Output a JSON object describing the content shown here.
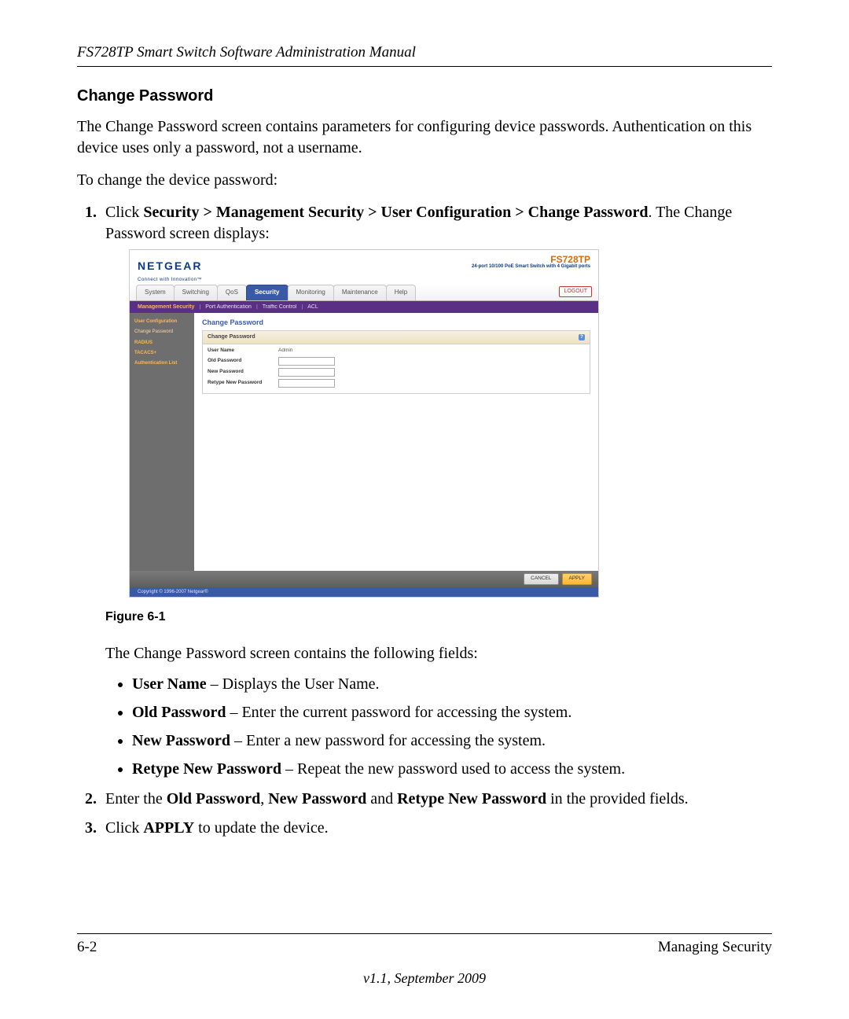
{
  "header": {
    "running_head": "FS728TP Smart Switch Software Administration Manual"
  },
  "section": {
    "title": "Change Password",
    "intro": "The Change Password screen contains parameters for configuring device passwords. Authentication on this device uses only a password, not a username.",
    "lead": "To change the device password:",
    "step1_prefix": "Click ",
    "step1_path": "Security > Management Security > User Configuration > Change Password",
    "step1_suffix": ". The Change Password screen displays:",
    "figure_caption": "Figure 6-1",
    "after_figure": "The Change Password screen contains the following fields:",
    "bullets": {
      "b0_term": "User Name",
      "b0_desc": " – Displays the User Name.",
      "b1_term": "Old Password",
      "b1_desc": " – Enter the current password for accessing the system.",
      "b2_term": "New Password",
      "b2_desc": " – Enter a new password for accessing the system.",
      "b3_term": "Retype New Password",
      "b3_desc": " – Repeat the new password used to access the system."
    },
    "step2_prefix": "Enter the ",
    "step2_t1": "Old Password",
    "step2_mid1": ", ",
    "step2_t2": "New Password",
    "step2_mid2": " and ",
    "step2_t3": "Retype New Password",
    "step2_suffix": " in the provided fields.",
    "step3_prefix": "Click ",
    "step3_term": "APPLY",
    "step3_suffix": " to update the device."
  },
  "footer": {
    "left": "6-2",
    "right": "Managing Security",
    "center": "v1.1, September 2009"
  },
  "screenshot": {
    "logo": "NETGEAR",
    "logo_tag": "Connect with Innovation™",
    "model": "FS728TP",
    "model_sub": "24-port 10/100 PoE Smart Switch with 4 Gigabit ports",
    "logout": "LOGOUT",
    "tabs": {
      "t0": "System",
      "t1": "Switching",
      "t2": "QoS",
      "t3": "Security",
      "t4": "Monitoring",
      "t5": "Maintenance",
      "t6": "Help"
    },
    "subnav": {
      "s0": "Management Security",
      "s1": "Port Authentication",
      "s2": "Traffic Control",
      "s3": "ACL"
    },
    "sidebar": {
      "i0": "User Configuration",
      "i1": "Change Password",
      "i2": "RADIUS",
      "i3": "TACACS+",
      "i4": "Authentication List"
    },
    "panel_title": "Change Password",
    "panel_head": "Change Password",
    "fields": {
      "f0_label": "User Name",
      "f0_value": "Admin",
      "f1_label": "Old Password",
      "f2_label": "New Password",
      "f3_label": "Retype New Password"
    },
    "buttons": {
      "cancel": "CANCEL",
      "apply": "APPLY"
    },
    "copyright": "Copyright © 1996-2007 Netgear®"
  }
}
